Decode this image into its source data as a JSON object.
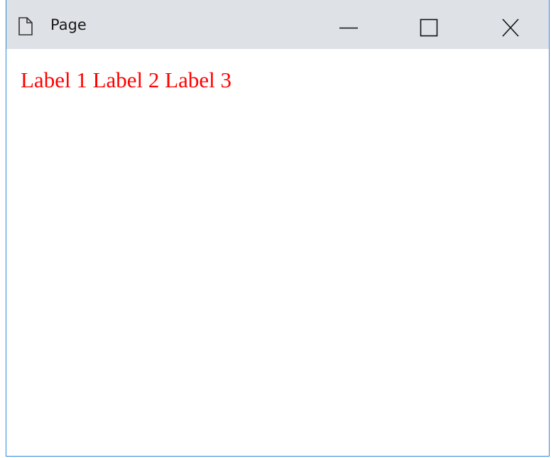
{
  "window": {
    "title": "Page",
    "icon": "page-icon",
    "controls": {
      "minimize_icon": "minimize-icon",
      "maximize_icon": "maximize-icon",
      "close_icon": "close-icon"
    }
  },
  "content": {
    "label_color": "#ff0000",
    "labels": [
      "Label 1",
      "Label 2",
      "Label 3"
    ]
  },
  "colors": {
    "titlebar": "#dee1e6",
    "border": "#2b88d8"
  }
}
